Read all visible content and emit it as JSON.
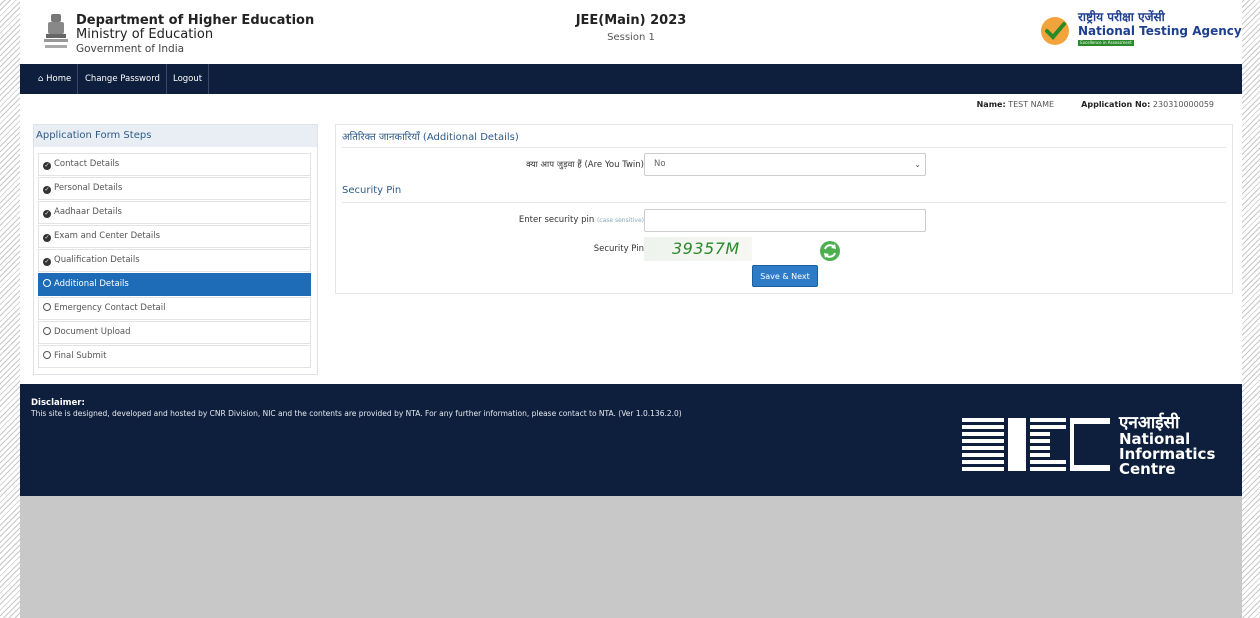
{
  "header": {
    "dept_line1": "Department of Higher Education",
    "dept_line2": "Ministry of Education",
    "dept_line3": "Government of India",
    "exam_title": "JEE(Main) 2023",
    "session": "Session 1",
    "agency_hindi": "राष्ट्रीय परीक्षा एजेंसी",
    "agency_name": "National Testing Agency",
    "agency_tagline": "Excellence in Assessment"
  },
  "nav": {
    "home": "Home",
    "change_password": "Change Password",
    "logout": "Logout"
  },
  "user": {
    "name_label": "Name:",
    "name_value": "TEST NAME",
    "appno_label": "Application No:",
    "appno_value": "230310000059"
  },
  "steps": {
    "title": "Application Form Steps",
    "items": [
      {
        "label": "Contact Details",
        "status": "done"
      },
      {
        "label": "Personal Details",
        "status": "done"
      },
      {
        "label": "Aadhaar Details",
        "status": "done"
      },
      {
        "label": "Exam and Center Details",
        "status": "done"
      },
      {
        "label": "Qualification Details",
        "status": "done"
      },
      {
        "label": "Additional Details",
        "status": "active"
      },
      {
        "label": "Emergency Contact Detail",
        "status": "pending"
      },
      {
        "label": "Document Upload",
        "status": "pending"
      },
      {
        "label": "Final Submit",
        "status": "pending"
      }
    ]
  },
  "form": {
    "section1_title": "अतिरिक्त जानकारियाँ (Additional Details)",
    "twin_label": "क्या आप जुड़वा हैं (Are You Twin)",
    "twin_value": "No",
    "section2_title": "Security Pin",
    "pin_label": "Enter security pin",
    "pin_hint": "(case sensitive)",
    "pin_value": "",
    "captcha_label": "Security Pin",
    "captcha_text": "39357M",
    "save_button": "Save & Next"
  },
  "footer": {
    "disclaimer_title": "Disclaimer:",
    "disclaimer_text": "This site is designed, developed and hosted by CNR Division, NIC and the contents are provided by NTA. For any further information, please contact to NTA. (Ver 1.0.136.2.0)",
    "nic_hindi": "एनआईसी",
    "nic_line1": "National",
    "nic_line2": "Informatics",
    "nic_line3": "Centre"
  },
  "colors": {
    "navbar": "#0d1f3c",
    "active_step": "#1e6bb8",
    "button": "#2e7cc7",
    "section_title": "#2d5a88",
    "captcha": "#2a8a2a"
  }
}
